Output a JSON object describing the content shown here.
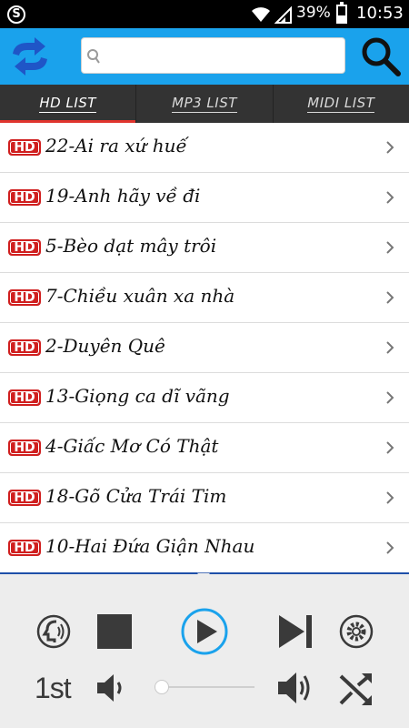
{
  "status_bar": {
    "app_icon": "skype-icon",
    "battery_text": "39%",
    "battery_level": 0.39,
    "time": "10:53"
  },
  "appbar": {
    "refresh_icon": "refresh-arrows-icon",
    "search_placeholder": "",
    "search_icon": "magnifier-icon"
  },
  "tabs": [
    {
      "label": "HD LIST",
      "active": true
    },
    {
      "label": "MP3 LIST",
      "active": false
    },
    {
      "label": "MIDI LIST",
      "active": false
    }
  ],
  "songs": [
    {
      "badge": "HD",
      "title": "22-Ai ra xứ huế"
    },
    {
      "badge": "HD",
      "title": "19-Anh hãy về đi"
    },
    {
      "badge": "HD",
      "title": "5-Bèo dạt mây trôi"
    },
    {
      "badge": "HD",
      "title": "7-Chiều xuân xa nhà"
    },
    {
      "badge": "HD",
      "title": "2-Duyên Quê"
    },
    {
      "badge": "HD",
      "title": "13-Giọng ca dĩ vãng"
    },
    {
      "badge": "HD",
      "title": "4-Giấc Mơ Có Thật"
    },
    {
      "badge": "HD",
      "title": "18-Gõ Cửa Trái Tim"
    },
    {
      "badge": "HD",
      "title": "10-Hai Đứa Giận Nhau"
    }
  ],
  "player": {
    "track_mode": "1st",
    "volume_level": 0.0,
    "icons": [
      "voice-icon",
      "stop-icon",
      "play-icon",
      "skip-next-icon",
      "settings-icon",
      "volume-down-icon",
      "volume-up-icon",
      "shuffle-icon"
    ]
  },
  "colors": {
    "appbar": "#1aa2ec",
    "tabs": "#333333",
    "active_tab_indicator": "#e0352e",
    "hd_badge": "#d01f1f",
    "player_accent": "#1aa2ec"
  }
}
